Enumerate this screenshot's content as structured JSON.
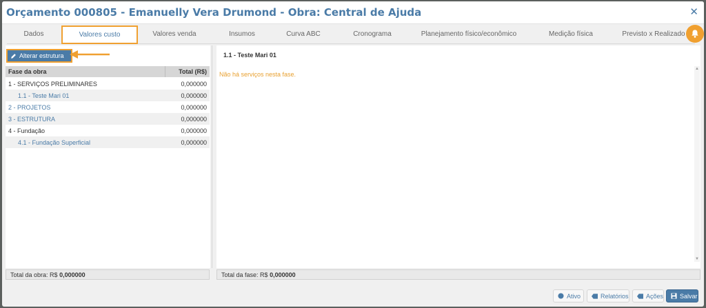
{
  "window": {
    "title": "Orçamento 000805 - Emanuelly Vera Drumond - Obra: Central de Ajuda",
    "close": "✕"
  },
  "tabs": [
    {
      "label": "Dados"
    },
    {
      "label": "Valores custo",
      "active": true
    },
    {
      "label": "Valores venda"
    },
    {
      "label": "Insumos"
    },
    {
      "label": "Curva ABC"
    },
    {
      "label": "Cronograma"
    },
    {
      "label": "Planejamento físico/econômico"
    },
    {
      "label": "Medição física"
    },
    {
      "label": "Previsto x Realizado"
    }
  ],
  "left": {
    "alterar_label": "Alterar estrutura",
    "grid": {
      "col_phase": "Fase da obra",
      "col_total": "Total (R$)",
      "rows": [
        {
          "name": "1 - SERVIÇOS PRELIMINARES",
          "value": "0,000000"
        },
        {
          "name": "1.1 - Teste Mari 01",
          "value": "0,000000"
        },
        {
          "name": "2 - PROJETOS",
          "value": "0,000000"
        },
        {
          "name": "3 - ESTRUTURA",
          "value": "0,000000"
        },
        {
          "name": "4 - Fundação",
          "value": "0,000000"
        },
        {
          "name": "4.1 - Fundação Superficial",
          "value": "0,000000"
        }
      ]
    },
    "total_label": "Total da obra: R$",
    "total_value": "0,000000"
  },
  "right": {
    "phase_title": "1.1 - Teste Mari 01",
    "empty_message": "Não há serviços nesta fase.",
    "total_label": "Total da fase: R$",
    "total_value": "0,000000"
  },
  "footer": {
    "ativo": "Ativo",
    "relatorios": "Relatórios",
    "acoes": "Ações",
    "salvar": "Salvar"
  },
  "colors": {
    "accent": "#4a7ba7",
    "highlight": "#f0a030",
    "warning_text": "#e8a030"
  }
}
